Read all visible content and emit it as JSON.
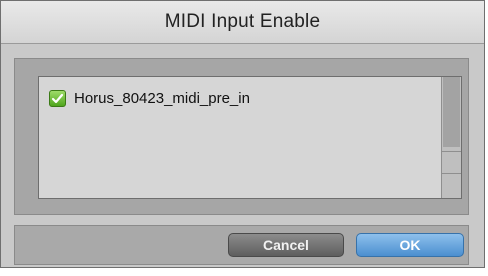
{
  "dialog": {
    "title": "MIDI Input Enable"
  },
  "list": {
    "items": [
      {
        "label": "Horus_80423_midi_pre_in",
        "checked": true
      }
    ]
  },
  "buttons": {
    "cancel_label": "Cancel",
    "ok_label": "OK"
  },
  "colors": {
    "checkbox_checked": "#4fa51d",
    "ok_button": "#4b8fd0",
    "cancel_button": "#6f6f6f"
  },
  "icons": {
    "checkbox": "checkmark-icon"
  }
}
